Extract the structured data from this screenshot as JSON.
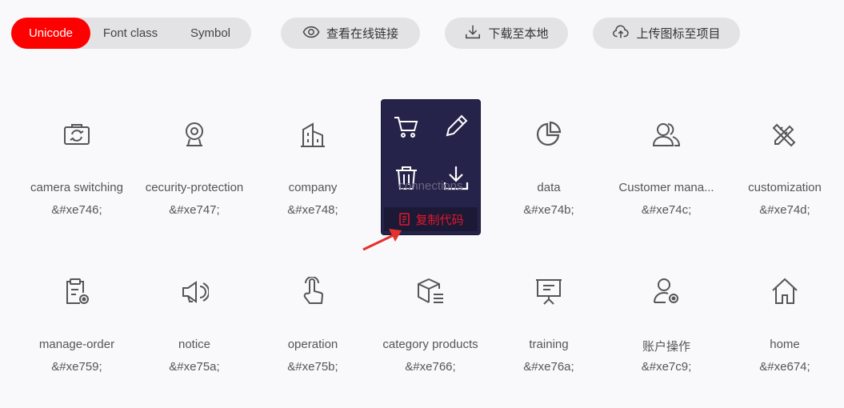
{
  "toolbar": {
    "tabs": [
      {
        "label": "Unicode",
        "active": true
      },
      {
        "label": "Font class",
        "active": false
      },
      {
        "label": "Symbol",
        "active": false
      }
    ],
    "view_online_label": "查看在线链接",
    "download_label": "下载至本地",
    "upload_label": "上传图标至项目"
  },
  "accent_color": "#ff0000",
  "icons_row1": [
    {
      "icon": "camera-switching-icon",
      "name": "camera switching",
      "code": "&#xe746;"
    },
    {
      "icon": "security-protection-icon",
      "name": "cecurity-protection",
      "code": "&#xe747;"
    },
    {
      "icon": "company-icon",
      "name": "company",
      "code": "&#xe748;"
    },
    {
      "icon": "connections-icon",
      "name": "connections",
      "code": ""
    },
    {
      "icon": "data-icon",
      "name": "data",
      "code": "&#xe74b;"
    },
    {
      "icon": "customer-management-icon",
      "name": "Customer mana...",
      "code": "&#xe74c;"
    },
    {
      "icon": "customization-icon",
      "name": "customization",
      "code": "&#xe74d;"
    }
  ],
  "icons_row2": [
    {
      "icon": "manage-order-icon",
      "name": "manage-order",
      "code": "&#xe759;"
    },
    {
      "icon": "notice-icon",
      "name": "notice",
      "code": "&#xe75a;"
    },
    {
      "icon": "operation-icon",
      "name": "operation",
      "code": "&#xe75b;"
    },
    {
      "icon": "category-products-icon",
      "name": "category products",
      "code": "&#xe766;"
    },
    {
      "icon": "training-icon",
      "name": "training",
      "code": "&#xe76a;"
    },
    {
      "icon": "account-operation-icon",
      "name": "账户操作",
      "code": "&#xe7c9;"
    },
    {
      "icon": "home-icon",
      "name": "home",
      "code": "&#xe674;"
    }
  ],
  "popup": {
    "copy_label": "复制代码",
    "actions": [
      "cart-icon",
      "edit-icon",
      "delete-icon",
      "download-icon"
    ]
  }
}
